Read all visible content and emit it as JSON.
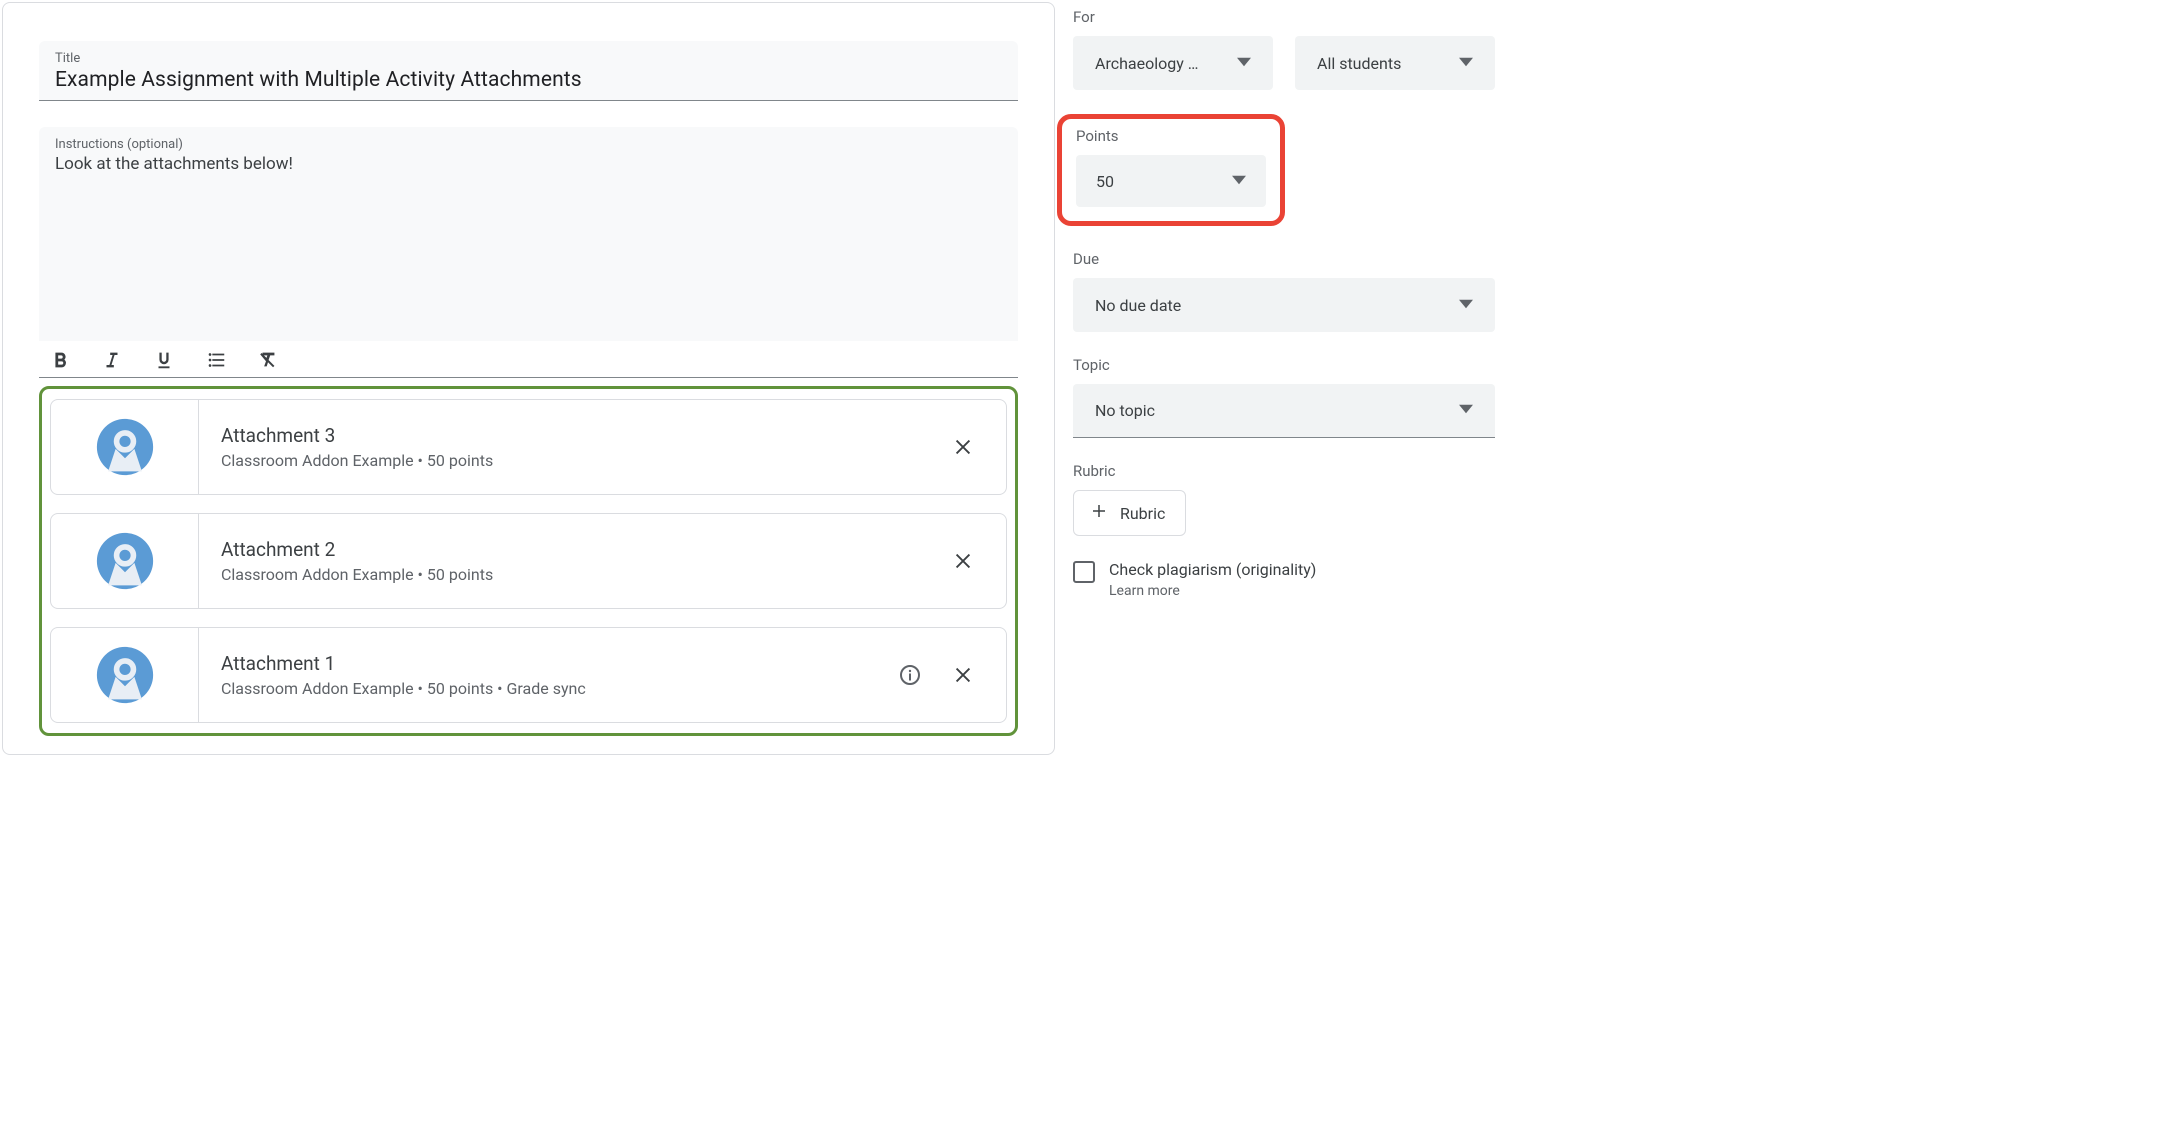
{
  "editor": {
    "title_label": "Title",
    "title_value": "Example Assignment with Multiple Activity Attachments",
    "instructions_label": "Instructions (optional)",
    "instructions_value": "Look at the attachments below!"
  },
  "attachments": [
    {
      "title": "Attachment 3",
      "subtitle": "Classroom Addon Example • 50 points",
      "has_info": false
    },
    {
      "title": "Attachment 2",
      "subtitle": "Classroom Addon Example • 50 points",
      "has_info": false
    },
    {
      "title": "Attachment 1",
      "subtitle": "Classroom Addon Example • 50 points • Grade sync",
      "has_info": true
    }
  ],
  "sidebar": {
    "for_label": "For",
    "class_value": "Archaeology …",
    "students_value": "All students",
    "points_label": "Points",
    "points_value": "50",
    "due_label": "Due",
    "due_value": "No due date",
    "topic_label": "Topic",
    "topic_value": "No topic",
    "rubric_label": "Rubric",
    "rubric_button": "Rubric",
    "plagiarism_label": "Check plagiarism (originality)",
    "learn_more": "Learn more"
  }
}
